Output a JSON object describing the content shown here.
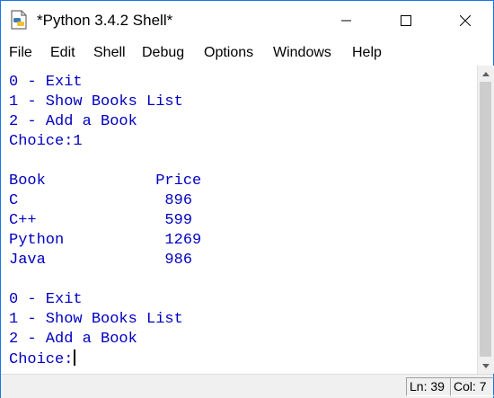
{
  "window": {
    "title": "*Python 3.4.2 Shell*",
    "icons": {
      "app": "python-idle-icon",
      "minimize": "minimize-icon",
      "maximize": "maximize-icon",
      "close": "close-icon"
    }
  },
  "menu": {
    "file": "File",
    "edit": "Edit",
    "shell": "Shell",
    "debug": "Debug",
    "options": "Options",
    "windows": "Windows",
    "help": "Help"
  },
  "editor": {
    "text_color": "#0000c0",
    "lines": [
      "0 - Exit",
      "1 - Show Books List",
      "2 - Add a Book",
      "Choice:1",
      "",
      "Book            Price",
      "C                896",
      "C++              599",
      "Python           1269",
      "Java             986",
      "",
      "0 - Exit",
      "1 - Show Books List",
      "2 - Add a Book",
      "Choice:"
    ]
  },
  "status": {
    "line": "Ln: 39",
    "column": "Col: 7"
  }
}
